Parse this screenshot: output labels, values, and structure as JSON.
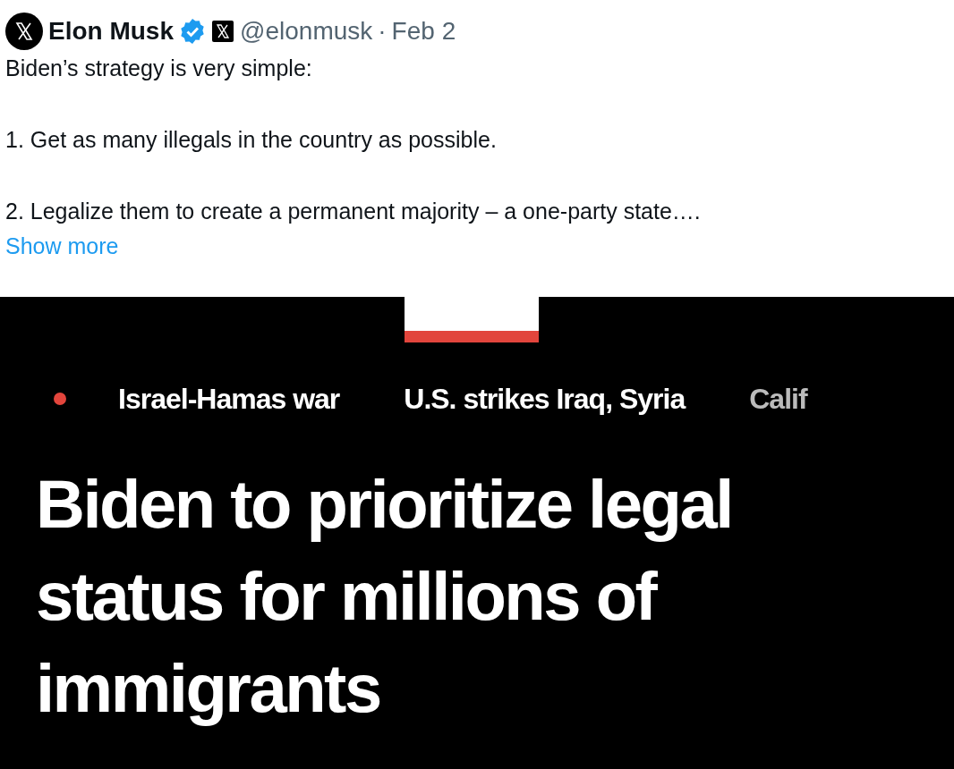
{
  "tweet": {
    "author": {
      "name": "Elon Musk",
      "verified": true,
      "handle": "@elonmusk",
      "separator": "·",
      "date": "Feb 2"
    },
    "paragraphs": [
      "Biden’s strategy is very simple:",
      "1. Get as many illegals in the country as possible.",
      "2. Legalize them to create a permanent majority – a one-party state…."
    ],
    "show_more": "Show more"
  },
  "news_screenshot": {
    "trending": [
      "Israel-Hamas war",
      "U.S. strikes Iraq, Syria",
      "Calif"
    ],
    "headline": "Biden to prioritize legal status for millions of immigrants"
  }
}
